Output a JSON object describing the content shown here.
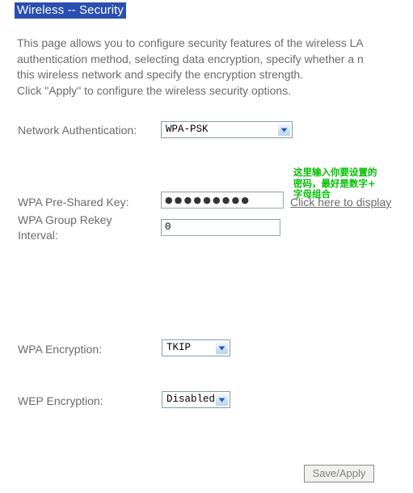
{
  "page": {
    "title": "Wireless -- Security",
    "title_highlight_color": "#2a4fb0",
    "background_color": "#ffffff",
    "text_color": "#6b6b6b"
  },
  "intro": {
    "line1": "This page allows you to configure security features of the wireless LA",
    "line2": "authentication method, selecting data encryption, specify whether a n",
    "line3": "this wireless network and specify the encryption strength.",
    "line4": "Click \"Apply\" to configure the wireless security options."
  },
  "form": {
    "network_authentication": {
      "label": "Network Authentication:",
      "value": "WPA-PSK"
    },
    "wpa_pre_shared_key": {
      "label": "WPA Pre-Shared Key:",
      "value": "●●●●●●●●●",
      "masked": "true"
    },
    "wpa_group_rekey_interval": {
      "label_line1": "WPA Group Rekey",
      "label_line2": "Interval:",
      "value": "0"
    },
    "wpa_encryption": {
      "label": "WPA Encryption:",
      "value": "TKIP"
    },
    "wep_encryption": {
      "label": "WEP Encryption:",
      "value": "Disabled"
    }
  },
  "link": {
    "display_key": "Click here to display"
  },
  "annotation": {
    "color": "#00c000",
    "line1": "这里输入你要设置的",
    "line2": "密码，最好是数字+",
    "line3": "字母组合"
  },
  "buttons": {
    "save_apply": "Save/Apply"
  }
}
